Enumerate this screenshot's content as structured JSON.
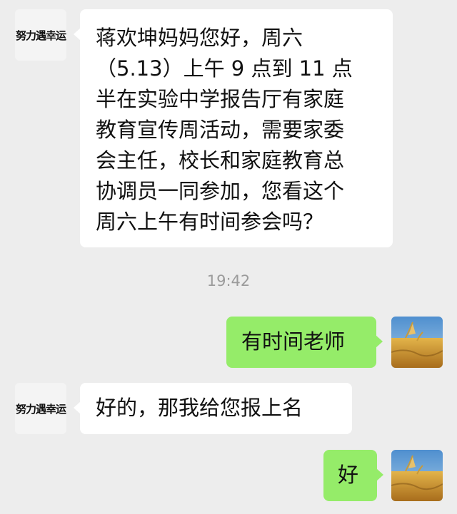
{
  "messages": [
    {
      "side": "incoming",
      "avatar_logo": "努力遇幸运",
      "lines": [
        "蒋欢坤妈妈您好，周六",
        "（5.13）上午 9 点到 11 点",
        "半在实验中学报告厅有家庭",
        "教育宣传周活动，需要家委",
        "会主任，校长和家庭教育总",
        "协调员一同参加，您看这个",
        "周六上午有时间参会吗？"
      ]
    },
    {
      "timestamp": "19:42"
    },
    {
      "side": "outgoing",
      "text": "有时间老师"
    },
    {
      "side": "incoming",
      "avatar_logo": "努力遇幸运",
      "text": "好的，那我给您报上名"
    },
    {
      "side": "outgoing",
      "text": "好"
    }
  ],
  "colors": {
    "background": "#ededed",
    "incoming_bubble": "#ffffff",
    "outgoing_bubble": "#95ec69",
    "timestamp": "#9b9b9b"
  },
  "icons": {
    "left_avatar": "brand-logo-avatar",
    "right_avatar": "wheat-field-photo-avatar"
  }
}
